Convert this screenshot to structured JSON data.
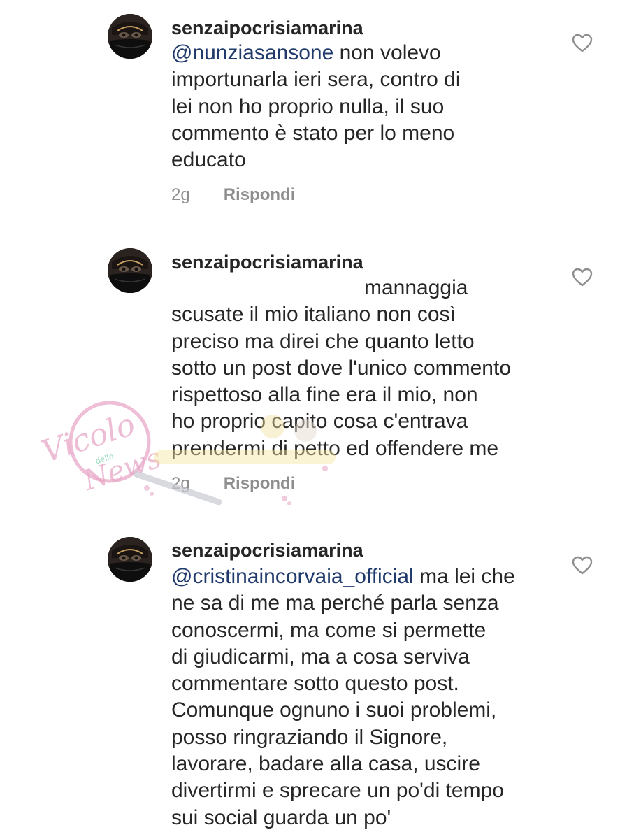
{
  "comments": [
    {
      "username": "senzaipocrisiamarina",
      "mention": "@nunziasansone",
      "text": "non volevo\nimportunarla ieri sera, contro di\nlei non ho proprio nulla, il suo\ncommento è stato per lo meno\neducato",
      "time": "2g",
      "reply": "Rispondi"
    },
    {
      "username": "senzaipocrisiamarina",
      "mention": "",
      "text": "mannaggia\nscusate il mio italiano non così\npreciso ma direi che quanto letto\nsotto un post dove l'unico commento\nrispettoso alla fine era il mio, non\nho proprio capito cosa c'entrava\nprendermi di petto ed offendere me",
      "time": "2g",
      "reply": "Rispondi"
    },
    {
      "username": "senzaipocrisiamarina",
      "mention": "@cristinaincorvaia_official",
      "text": "ma lei che\nne sa di me ma perché parla senza\nconoscermi, ma come si permette\ndi giudicarmi, ma a cosa serviva\ncommentare sotto questo post.\nComunque ognuno i suoi problemi,\nposso ringraziando il Signore,\nlavorare, badare alla casa, uscire\ndivertirmi e sprecare un po'di tempo\nsui social guarda un po'"
    }
  ],
  "watermark": {
    "line1": "Vicolo",
    "line2": "delle",
    "line3": "News"
  },
  "colors": {
    "text": "#262626",
    "mention": "#1f3a6b",
    "meta": "#8e8e8e",
    "watermark": "#e8a8c8"
  },
  "icons": {
    "like": "heart-outline-icon",
    "avatar": "masked-face-avatar"
  }
}
